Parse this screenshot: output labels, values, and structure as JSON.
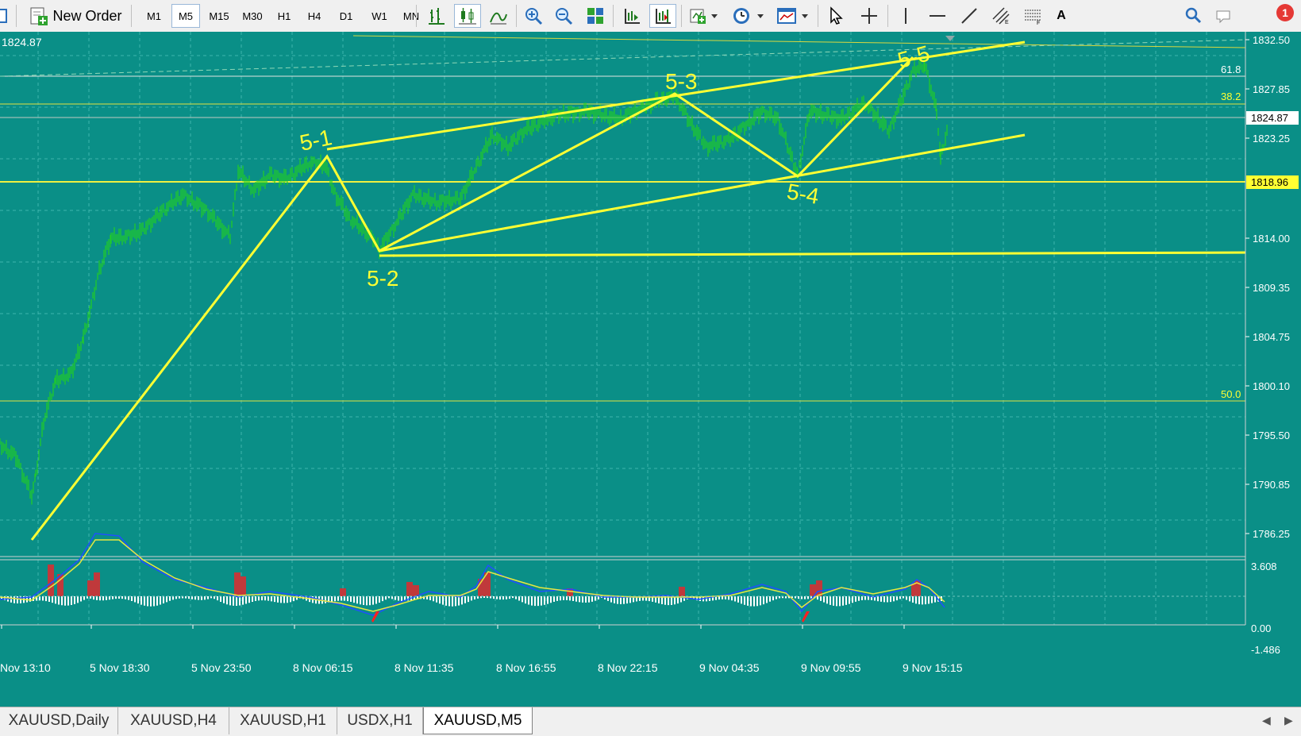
{
  "toolbar": {
    "new_order": "New Order",
    "timeframes": [
      "M1",
      "M5",
      "M15",
      "M30",
      "H1",
      "H4",
      "D1",
      "W1",
      "MN"
    ],
    "active_timeframe": "M5",
    "text_tool": "A",
    "notification_count": "1"
  },
  "chart": {
    "top_left_price": "1824.87",
    "price_axis": [
      "1832.50",
      "1827.85",
      "1823.25",
      "1818.96",
      "1814.00",
      "1809.35",
      "1804.75",
      "1800.10",
      "1795.50",
      "1790.85",
      "1786.25"
    ],
    "current_price_label": "1824.87",
    "level_price_label": "1818.96",
    "fib_labels": [
      "61.8",
      "38.2",
      "50.0"
    ],
    "wave_labels": [
      "5-1",
      "5-2",
      "5-3",
      "5-4",
      "5-5"
    ],
    "time_axis": [
      "Nov 13:10",
      "5 Nov 18:30",
      "5 Nov 23:50",
      "8 Nov 06:15",
      "8 Nov 11:35",
      "8 Nov 16:55",
      "8 Nov 22:15",
      "9 Nov 04:35",
      "9 Nov 09:55",
      "9 Nov 15:15"
    ],
    "indicator_axis": [
      "3.608",
      "0.00",
      "-1.486"
    ]
  },
  "tabs": [
    "XAUUSD,Daily",
    "XAUUSD,H4",
    "XAUUSD,H1",
    "USDX,H1",
    "XAUUSD,M5"
  ],
  "active_tab": "XAUUSD,M5",
  "colors": {
    "background": "#0a8f87",
    "candles": "#22d022",
    "drawings": "#ffff33",
    "grid": "#3fb5ad"
  }
}
